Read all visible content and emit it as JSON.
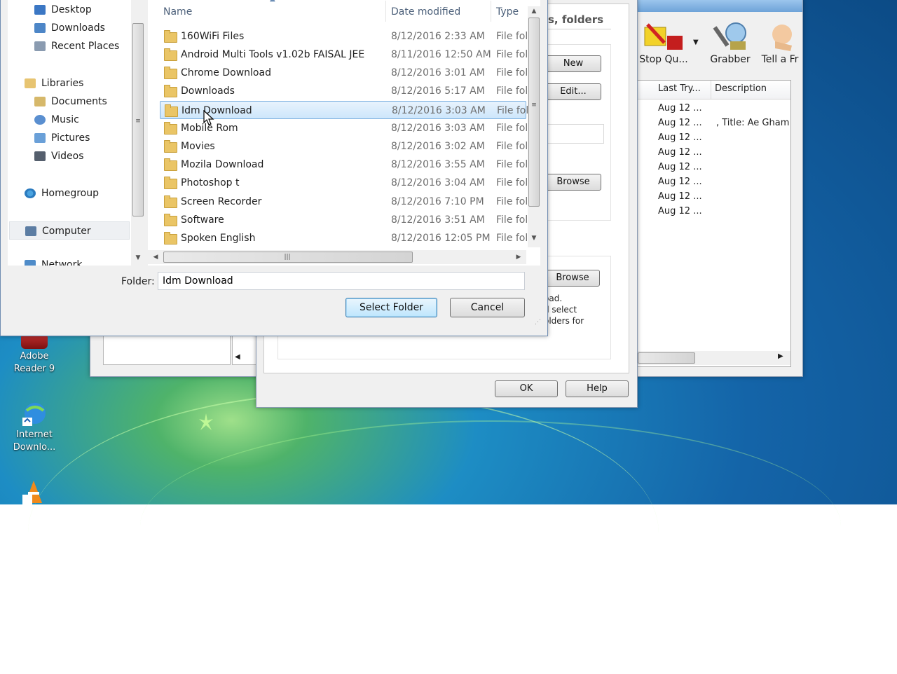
{
  "desktop": {
    "icons": [
      {
        "label": "Adobe Reader 9",
        "icon": "adobe-reader-icon"
      },
      {
        "label": "Internet Downlo...",
        "icon": "idm-icon"
      },
      {
        "label": "",
        "icon": "vlc-icon"
      }
    ]
  },
  "idm_main": {
    "toolbar": [
      {
        "label": "Stop Qu...",
        "icon": "stop-queue-icon"
      },
      {
        "label": "Grabber",
        "icon": "grabber-icon"
      },
      {
        "label": "Tell a Fr",
        "icon": "tell-friend-icon"
      }
    ],
    "columns": [
      "Last Try...",
      "Description"
    ],
    "rows": [
      {
        "last_try": "Aug 12 ...",
        "description": ""
      },
      {
        "last_try": "Aug 12 ...",
        "description": ", Title: Ae Gham E"
      },
      {
        "last_try": "Aug 12 ...",
        "description": ""
      },
      {
        "last_try": "Aug 12 ...",
        "description": ""
      },
      {
        "last_try": "Aug 12 ...",
        "description": ""
      },
      {
        "last_try": "Aug 12 ...",
        "description": ""
      },
      {
        "last_try": "Aug 12 ...",
        "description": ""
      },
      {
        "last_try": "Aug 12 ...",
        "description": ""
      }
    ]
  },
  "options_dialog": {
    "heading": "s, folders",
    "new_label": "New",
    "edit_label": "Edit...",
    "browse1_label": "Browse",
    "browse2_label": "Browse",
    "hint_lines": [
      "oad.",
      "d select",
      "olders for"
    ],
    "ok_label": "OK",
    "help_label": "Help"
  },
  "file_dialog": {
    "nav_pane": {
      "favorites": [
        {
          "label": "Desktop",
          "icon": "desktop-icon"
        },
        {
          "label": "Downloads",
          "icon": "downloads-folder-icon"
        },
        {
          "label": "Recent Places",
          "icon": "recent-places-icon"
        }
      ],
      "libraries_label": "Libraries",
      "libraries": [
        {
          "label": "Documents",
          "icon": "documents-icon"
        },
        {
          "label": "Music",
          "icon": "music-icon"
        },
        {
          "label": "Pictures",
          "icon": "pictures-icon"
        },
        {
          "label": "Videos",
          "icon": "videos-icon"
        }
      ],
      "homegroup_label": "Homegroup",
      "computer_label": "Computer",
      "network_label": "Network"
    },
    "columns": {
      "name": "Name",
      "date": "Date modified",
      "type": "Type"
    },
    "files": [
      {
        "name": "160WiFi Files",
        "date": "8/12/2016 2:33 AM",
        "type": "File fol"
      },
      {
        "name": "Android Multi Tools v1.02b FAISAL JEE",
        "date": "8/11/2016 12:50 AM",
        "type": "File fol"
      },
      {
        "name": "Chrome Download",
        "date": "8/12/2016 3:01 AM",
        "type": "File fol"
      },
      {
        "name": "Downloads",
        "date": "8/12/2016 5:17 AM",
        "type": "File fol"
      },
      {
        "name": "Idm Download",
        "date": "8/12/2016 3:03 AM",
        "type": "File fol",
        "selected": true
      },
      {
        "name": "Mobile Rom",
        "date": "8/12/2016 3:03 AM",
        "type": "File fol"
      },
      {
        "name": "Movies",
        "date": "8/12/2016 3:02 AM",
        "type": "File fol"
      },
      {
        "name": "Mozila Download",
        "date": "8/12/2016 3:55 AM",
        "type": "File fol"
      },
      {
        "name": "Photoshop t",
        "date": "8/12/2016 3:04 AM",
        "type": "File fol"
      },
      {
        "name": "Screen Recorder",
        "date": "8/12/2016 7:10 PM",
        "type": "File fol"
      },
      {
        "name": "Software",
        "date": "8/12/2016 3:51 AM",
        "type": "File fol"
      },
      {
        "name": "Spoken English",
        "date": "8/12/2016 12:05 PM",
        "type": "File fol"
      }
    ],
    "folder_label": "Folder:",
    "folder_value": "Idm Download",
    "select_label": "Select Folder",
    "cancel_label": "Cancel"
  }
}
